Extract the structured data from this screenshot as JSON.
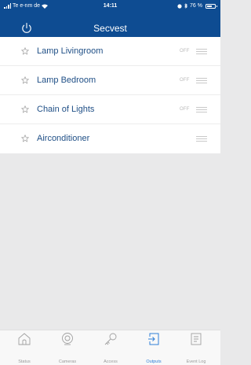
{
  "status_bar": {
    "carrier": "Te e-nm de",
    "time": "14:11",
    "battery_text": "76 %"
  },
  "header": {
    "title": "Secvest"
  },
  "outputs": [
    {
      "label": "Lamp Livingroom",
      "state": "OFF"
    },
    {
      "label": "Lamp Bedroom",
      "state": "OFF"
    },
    {
      "label": "Chain of Lights",
      "state": "OFF"
    },
    {
      "label": "Airconditioner",
      "state": ""
    }
  ],
  "tabs": [
    {
      "label": "Status",
      "icon": "home-icon",
      "active": false
    },
    {
      "label": "Cameras",
      "icon": "camera-icon",
      "active": false
    },
    {
      "label": "Access",
      "icon": "key-icon",
      "active": false
    },
    {
      "label": "Outputs",
      "icon": "outputs-icon",
      "active": true
    },
    {
      "label": "Event Log",
      "icon": "event-log-icon",
      "active": false
    }
  ],
  "colors": {
    "header": "#0e4c92",
    "active_tab": "#2f7fd8",
    "row_text": "#1f4f86"
  }
}
